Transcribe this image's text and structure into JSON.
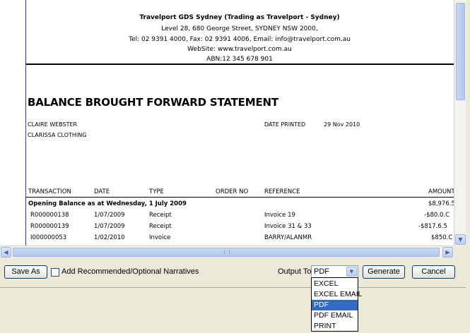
{
  "header": {
    "company": "Travelport GDS Sydney (Trading as Travelport - Sydney)",
    "address": "Level 28, 680 George Street, SYDNEY NSW 2000,",
    "contact": "Tel: 02 9391 4000, Fax: 02 9391 4006, Email: info@travelport.com.au",
    "website": "WebSite: www.travelport.com.au",
    "abn": "ABN:12 345 678 901"
  },
  "statement": {
    "title": "BALANCE BROUGHT FORWARD STATEMENT",
    "customer_name": "CLAIRE WEBSTER",
    "customer_company": "CLARISSA CLOTHING",
    "date_printed_label": "DATE PRINTED",
    "date_printed_value": "29 Nov 2010"
  },
  "table": {
    "headers": {
      "transaction": "TRANSACTION",
      "date": "DATE",
      "type": "TYPE",
      "order_no": "ORDER NO",
      "reference": "REFERENCE",
      "amount": "AMOUNT"
    },
    "opening_label": "Opening Balance as at Wednesday, 1 July 2009",
    "opening_amount": "$8,976.5",
    "rows": [
      {
        "transaction": "R000000138",
        "date": "1/07/2009",
        "type": "Receipt",
        "order_no": "",
        "reference": "Invoice 19",
        "amount": "-$80.0.C"
      },
      {
        "transaction": "R000000139",
        "date": "1/07/2009",
        "type": "Receipt",
        "order_no": "",
        "reference": "Invoice 31 & 33",
        "amount": "-$817.6.5"
      },
      {
        "transaction": "I000000053",
        "date": "1/02/2010",
        "type": "Invoice",
        "order_no": "",
        "reference": "BARRY/ALANMR",
        "amount": "$850.C"
      }
    ]
  },
  "toolbar": {
    "save_as": "Save As",
    "narratives_label": "Add Recommended/Optional Narratives",
    "output_label": "Output To:",
    "output_value": "PDF",
    "generate": "Generate",
    "cancel": "Cancel"
  },
  "output_options": [
    "EXCEL",
    "EXCEL EMAIL",
    "PDF",
    "PDF EMAIL",
    "PRINT"
  ],
  "output_selected_index": 2,
  "icons": {
    "scroll_left": "◀",
    "scroll_right": "▶",
    "scroll_down": "▼",
    "dropdown_arrow": "▼"
  },
  "colors": {
    "selection": "#316ac5",
    "margin_line": "#3a3aa6",
    "button_border": "#003c74"
  }
}
